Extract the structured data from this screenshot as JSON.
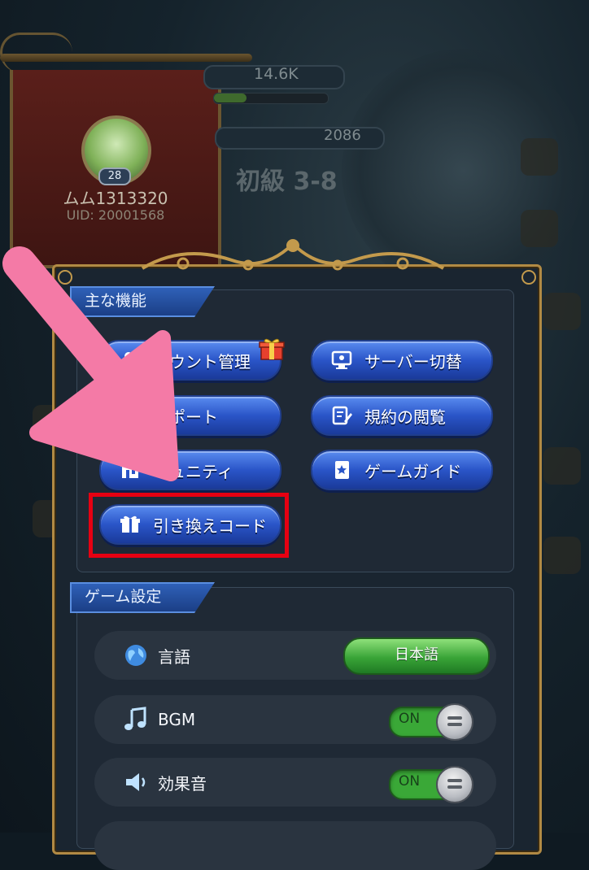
{
  "player": {
    "level": "28",
    "name": "ムム1313320",
    "uid": "UID: 20001568"
  },
  "hud": {
    "power": "14.6K",
    "gems": "2086",
    "stage": "初級 3-8"
  },
  "menu": {
    "main_section_title": "主な機能",
    "buttons": {
      "account": "カウント管理",
      "server": "サーバー切替",
      "support": "サポート",
      "terms": "規約の閲覧",
      "community": "ミュニティ",
      "guide": "ゲームガイド",
      "redeem": "引き換えコード"
    },
    "game_section_title": "ゲーム設定",
    "settings": {
      "language_label": "言語",
      "language_value": "日本語",
      "bgm_label": "BGM",
      "bgm_state": "ON",
      "sfx_label": "効果音",
      "sfx_state": "ON"
    }
  },
  "colors": {
    "highlight": "#e60012",
    "arrow": "#f47aa6",
    "button_blue": "#2a55c8",
    "toggle_green": "#3aa837"
  }
}
